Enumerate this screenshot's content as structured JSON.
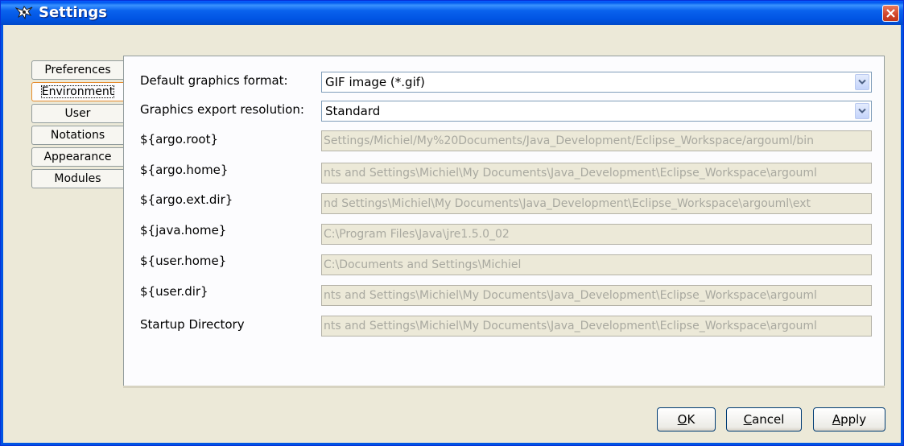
{
  "window": {
    "title": "Settings",
    "icon": "argouml-app-icon",
    "close_icon": "close-icon"
  },
  "tabs": [
    {
      "label": "Preferences",
      "selected": false
    },
    {
      "label": "Environment",
      "selected": true
    },
    {
      "label": "User",
      "selected": false
    },
    {
      "label": "Notations",
      "selected": false
    },
    {
      "label": "Appearance",
      "selected": false
    },
    {
      "label": "Modules",
      "selected": false
    }
  ],
  "environment": {
    "graphics_format": {
      "label": "Default graphics format:",
      "value": "GIF image (*.gif)"
    },
    "export_resolution": {
      "label": "Graphics export resolution:",
      "value": "Standard"
    },
    "argo_root": {
      "label": "${argo.root}",
      "value": "Settings/Michiel/My%20Documents/Java_Development/Eclipse_Workspace/argouml/bin"
    },
    "argo_home": {
      "label": "${argo.home}",
      "value": "nts and Settings\\Michiel\\My Documents\\Java_Development\\Eclipse_Workspace\\argouml"
    },
    "argo_ext_dir": {
      "label": "${argo.ext.dir}",
      "value": "nd Settings\\Michiel\\My Documents\\Java_Development\\Eclipse_Workspace\\argouml\\ext"
    },
    "java_home": {
      "label": "${java.home}",
      "value": "C:\\Program Files\\Java\\jre1.5.0_02"
    },
    "user_home": {
      "label": "${user.home}",
      "value": "C:\\Documents and Settings\\Michiel"
    },
    "user_dir": {
      "label": "${user.dir}",
      "value": "nts and Settings\\Michiel\\My Documents\\Java_Development\\Eclipse_Workspace\\argouml"
    },
    "startup_dir": {
      "label": "Startup Directory",
      "value": "nts and Settings\\Michiel\\My Documents\\Java_Development\\Eclipse_Workspace\\argouml"
    }
  },
  "buttons": {
    "ok": {
      "mnemonic": "O",
      "rest": "K"
    },
    "cancel": {
      "mnemonic": "C",
      "rest": "ancel"
    },
    "apply": {
      "mnemonic": "A",
      "rest": "pply"
    }
  }
}
